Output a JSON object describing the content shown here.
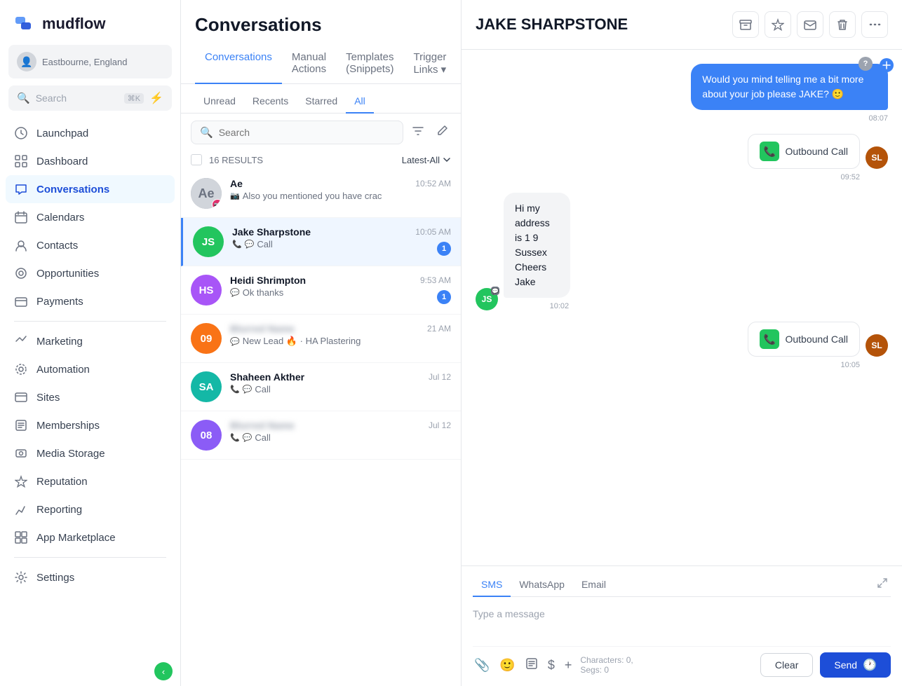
{
  "app": {
    "logo_text": "mudflow"
  },
  "sidebar": {
    "user_location": "Eastbourne, England",
    "search_placeholder": "Search",
    "search_shortcut": "⌘K",
    "nav_items": [
      {
        "id": "launchpad",
        "label": "Launchpad",
        "icon": "🚀"
      },
      {
        "id": "dashboard",
        "label": "Dashboard",
        "icon": "▦"
      },
      {
        "id": "conversations",
        "label": "Conversations",
        "icon": "💬",
        "active": true
      },
      {
        "id": "calendars",
        "label": "Calendars",
        "icon": "📅"
      },
      {
        "id": "contacts",
        "label": "Contacts",
        "icon": "👤"
      },
      {
        "id": "opportunities",
        "label": "Opportunities",
        "icon": "⚙️"
      },
      {
        "id": "payments",
        "label": "Payments",
        "icon": "🧾"
      }
    ],
    "nav_items2": [
      {
        "id": "marketing",
        "label": "Marketing",
        "icon": "✉️"
      },
      {
        "id": "automation",
        "label": "Automation",
        "icon": "◎"
      },
      {
        "id": "sites",
        "label": "Sites",
        "icon": "▣"
      },
      {
        "id": "memberships",
        "label": "Memberships",
        "icon": "🖼️"
      },
      {
        "id": "media-storage",
        "label": "Media Storage",
        "icon": "🖼️"
      },
      {
        "id": "reputation",
        "label": "Reputation",
        "icon": "⭐"
      },
      {
        "id": "reporting",
        "label": "Reporting",
        "icon": "📈"
      },
      {
        "id": "app-marketplace",
        "label": "App Marketplace",
        "icon": "⊞"
      }
    ],
    "settings_label": "Settings"
  },
  "conv_panel": {
    "title": "Conversations",
    "tabs": [
      {
        "id": "conversations",
        "label": "Conversations",
        "active": true
      },
      {
        "id": "manual-actions",
        "label": "Manual Actions"
      },
      {
        "id": "templates",
        "label": "Templates (Snippets)"
      },
      {
        "id": "trigger-links",
        "label": "Trigger Links ▾"
      }
    ],
    "subtabs": [
      {
        "id": "unread",
        "label": "Unread"
      },
      {
        "id": "recents",
        "label": "Recents"
      },
      {
        "id": "starred",
        "label": "Starred"
      },
      {
        "id": "all",
        "label": "All",
        "active": true
      }
    ],
    "search_placeholder": "Search",
    "results_count": "16 RESULTS",
    "sort_label": "Latest-All",
    "conversations": [
      {
        "id": "ae",
        "name": "Ae",
        "avatar_color": "#6b7280",
        "avatar_text": "",
        "avatar_img": true,
        "channel": "instagram",
        "time": "10:52 AM",
        "preview": "Also you mentioned you have crac",
        "badge": null
      },
      {
        "id": "jake-sharpstone",
        "name": "Jake Sharpstone",
        "avatar_color": "#22c55e",
        "avatar_text": "JS",
        "channel": "call",
        "time": "10:05 AM",
        "preview": "Call",
        "badge": "1",
        "active": true
      },
      {
        "id": "heidi-shrimpton",
        "name": "Heidi Shrimpton",
        "avatar_color": "#a855f7",
        "avatar_text": "HS",
        "channel": "sms",
        "time": "9:53 AM",
        "preview": "Ok thanks",
        "badge": "1"
      },
      {
        "id": "contact-09",
        "name": "BLURRED CONTACT",
        "avatar_color": "#f97316",
        "avatar_text": "09",
        "channel": "sms",
        "time": "21 AM",
        "preview": "New Lead 🔥 · HA Plastering",
        "badge": null
      },
      {
        "id": "shaheen-akther",
        "name": "Shaheen Akther",
        "avatar_color": "#14b8a6",
        "avatar_text": "SA",
        "channel": "call",
        "time": "Jul 12",
        "preview": "Call",
        "badge": null
      },
      {
        "id": "contact-08",
        "name": "BLURRED CONTACT",
        "avatar_color": "#8b5cf6",
        "avatar_text": "08",
        "channel": "call",
        "time": "Jul 12",
        "preview": "Call",
        "badge": null
      }
    ]
  },
  "chat": {
    "contact_name": "JAKE SHARPSTONE",
    "messages": [
      {
        "id": "msg1",
        "type": "outgoing",
        "text": "Would you mind telling me a bit more about your job please JAKE? 🙂",
        "time": "08:07",
        "has_badge": true
      },
      {
        "id": "call1",
        "type": "call",
        "label": "Outbound Call",
        "time": "09:52",
        "avatar_color": "#b45309",
        "avatar_text": "SL"
      },
      {
        "id": "msg2",
        "type": "incoming",
        "text": "Hi my address is 1 9\nSussex\nCheers Jake",
        "time": "10:02",
        "avatar_color": "#22c55e",
        "avatar_text": "JS"
      },
      {
        "id": "call2",
        "type": "call",
        "label": "Outbound Call",
        "time": "10:05",
        "avatar_color": "#b45309",
        "avatar_text": "SL"
      }
    ],
    "composer": {
      "tabs": [
        "SMS",
        "WhatsApp",
        "Email"
      ],
      "active_tab": "SMS",
      "placeholder": "Type a message",
      "chars_label": "Characters: 0,",
      "segs_label": "Segs: 0",
      "clear_label": "Clear",
      "send_label": "Send"
    }
  }
}
